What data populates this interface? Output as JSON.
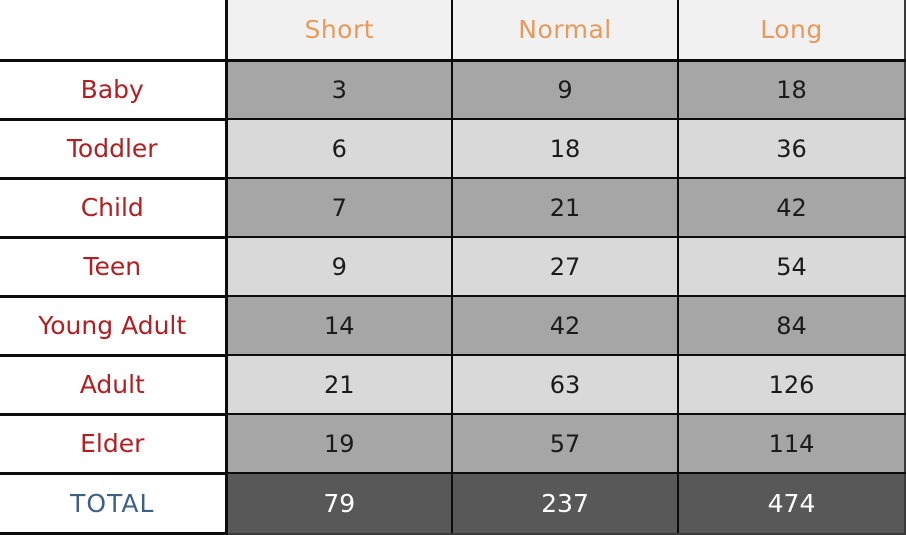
{
  "table": {
    "corner_label": "",
    "columns": [
      "Short",
      "Normal",
      "Long"
    ],
    "row_header_label": "",
    "rows": [
      {
        "label": "Baby",
        "values": [
          "3",
          "9",
          "18"
        ]
      },
      {
        "label": "Toddler",
        "values": [
          "6",
          "18",
          "36"
        ]
      },
      {
        "label": "Child",
        "values": [
          "7",
          "21",
          "42"
        ]
      },
      {
        "label": "Teen",
        "values": [
          "9",
          "27",
          "54"
        ]
      },
      {
        "label": "Young Adult",
        "values": [
          "14",
          "42",
          "84"
        ]
      },
      {
        "label": "Adult",
        "values": [
          "21",
          "63",
          "126"
        ]
      },
      {
        "label": "Elder",
        "values": [
          "19",
          "57",
          "114"
        ]
      }
    ],
    "total": {
      "label": "TOTAL",
      "values": [
        "79",
        "237",
        "474"
      ]
    },
    "colors": {
      "header_text": "#e89a5d",
      "header_background": "#f1f1f1",
      "row_label_text": "#b21f23",
      "total_label_text": "#3d6085",
      "band_dark": "#a6a6a6",
      "band_light": "#d9d9d9",
      "total_background": "#585858",
      "total_value_text": "#ffffff",
      "border": "#0c0c0c"
    }
  },
  "chart_data": {
    "type": "table",
    "title": "",
    "categories": [
      "Baby",
      "Toddler",
      "Child",
      "Teen",
      "Young Adult",
      "Adult",
      "Elder"
    ],
    "series": [
      {
        "name": "Short",
        "values": [
          3,
          6,
          7,
          9,
          14,
          21,
          19
        ],
        "total": 79
      },
      {
        "name": "Normal",
        "values": [
          9,
          18,
          21,
          27,
          42,
          63,
          57
        ],
        "total": 237
      },
      {
        "name": "Long",
        "values": [
          18,
          36,
          42,
          54,
          84,
          126,
          114
        ],
        "total": 474
      }
    ],
    "xlabel": "",
    "ylabel": "",
    "legend": "none",
    "grid": true
  }
}
